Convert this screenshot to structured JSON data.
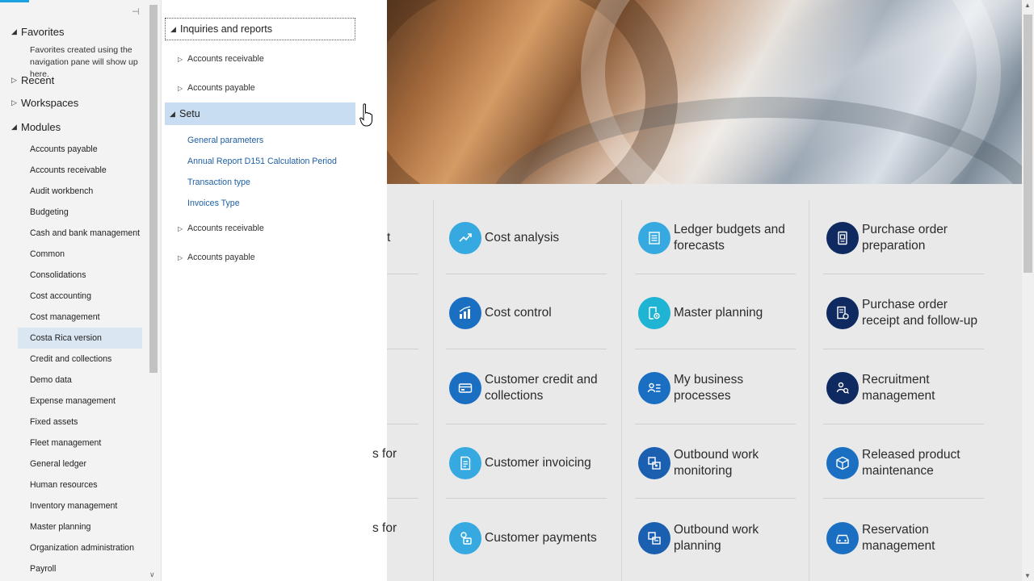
{
  "nav": {
    "favorites": "Favorites",
    "favorites_hint": "Favorites created using the navigation pane will show up here.",
    "recent": "Recent",
    "workspaces": "Workspaces",
    "modules": "Modules",
    "module_items": [
      "Accounts payable",
      "Accounts receivable",
      "Audit workbench",
      "Budgeting",
      "Cash and bank management",
      "Common",
      "Consolidations",
      "Cost accounting",
      "Cost management",
      "Costa Rica version",
      "Credit and collections",
      "Demo data",
      "Expense management",
      "Fixed assets",
      "Fleet management",
      "General ledger",
      "Human resources",
      "Inventory management",
      "Master planning",
      "Organization administration",
      "Payroll"
    ]
  },
  "flyout": {
    "header": "Inquiries and reports",
    "group1": "Accounts receivable",
    "group2": "Accounts payable",
    "setup": "Setu",
    "links": [
      "General parameters",
      "Annual Report D151 Calculation Period",
      "Transaction type",
      "Invoices Type"
    ],
    "group3": "Accounts receivable",
    "group4": "Accounts payable"
  },
  "partial": {
    "t1": "t",
    "t4": "s for",
    "t5": "s for"
  },
  "tiles": {
    "c1": [
      "Cost analysis",
      "Cost control",
      "Customer credit and collections",
      "Customer invoicing",
      "Customer payments"
    ],
    "c2": [
      "Ledger budgets and forecasts",
      "Master planning",
      "My business processes",
      "Outbound work monitoring",
      "Outbound work planning"
    ],
    "c3": [
      "Purchase order preparation",
      "Purchase order receipt and follow-up",
      "Recruitment management",
      "Released product maintenance",
      "Reservation management"
    ]
  },
  "colors": {
    "light_blue": "#36a9e1",
    "blue": "#1b6fc2",
    "navy": "#0f2a60",
    "teal": "#1fb3d4",
    "selection": "#c8ddf2",
    "link": "#1f5fa5"
  }
}
